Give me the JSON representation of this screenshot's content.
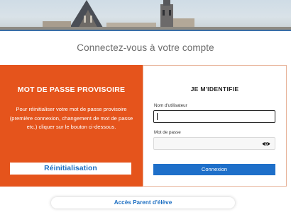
{
  "header": {
    "title": "Connectez-vous à votre compte"
  },
  "reset_panel": {
    "heading": "MOT DE PASSE PROVISOIRE",
    "description": "Pour réinitialiser votre mot de passe provisoire (première connexion, changement de mot de passe etc.) cliquer sur le bouton ci-dessous.",
    "button_label": "Réinitialisation",
    "background_color": "#e5541c"
  },
  "login_panel": {
    "heading": "JE M'IDENTIFIE",
    "username_label": "Nom d'utilisateur",
    "username_value": "",
    "password_label": "Mot de passe",
    "password_value": "",
    "password_toggle_icon": "eye-icon",
    "submit_label": "Connexion",
    "accent_color": "#1e6fc9"
  },
  "footer": {
    "parent_access_label": "Accès Parent d'élève"
  }
}
